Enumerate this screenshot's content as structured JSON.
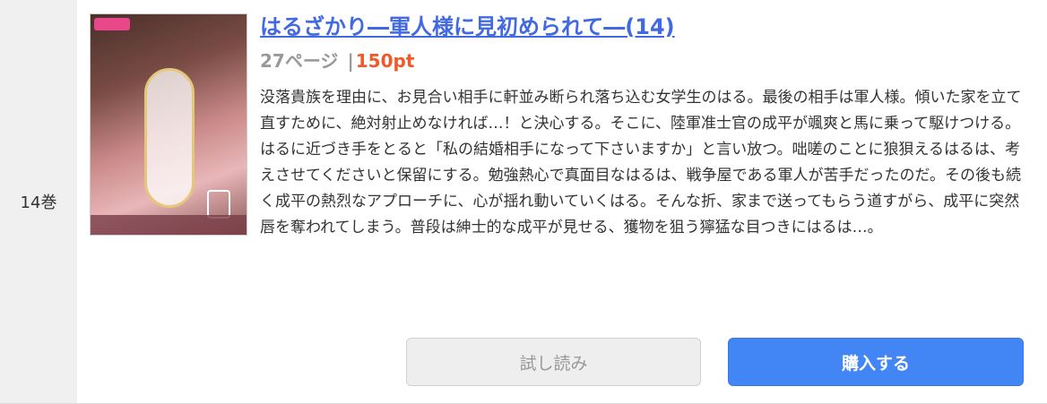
{
  "volume_label": "14巻",
  "book": {
    "title": "はるざかり―軍人様に見初められて―(14)",
    "pages": "27ページ",
    "separator": "|",
    "price": "150pt",
    "description": "没落貴族を理由に、お見合い相手に軒並み断られ落ち込む女学生のはる。最後の相手は軍人様。傾いた家を立て直すために、絶対射止めなければ…！と決心する。そこに、陸軍准士官の成平が颯爽と馬に乗って駆けつける。はるに近づき手をとると「私の結婚相手になって下さいますか」と言い放つ。咄嗟のことに狼狽えるはるは、考えさせてくださいと保留にする。勉強熱心で真面目なはるは、戦争屋である軍人が苦手だったのだ。その後も続く成平の熱烈なアプローチに、心が揺れ動いていくはる。そんな折、家まで送ってもらう道すがら、成平に突然唇を奪われてしまう。普段は紳士的な成平が見せる、獲物を狙う獰猛な目つきにはるは…。"
  },
  "buttons": {
    "trial_label": "試し読み",
    "buy_label": "購入する"
  },
  "colors": {
    "title_link": "#4169e1",
    "price": "#f05a28",
    "buy_button": "#4285f4",
    "trial_button": "#eeeeee"
  }
}
